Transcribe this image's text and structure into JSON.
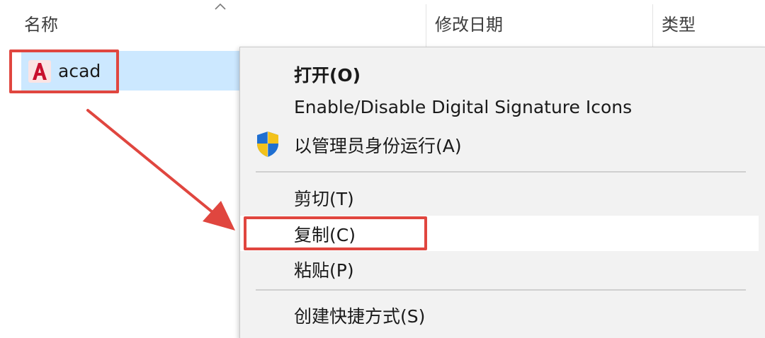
{
  "header": {
    "col_name": "名称",
    "col_date": "修改日期",
    "col_type": "类型"
  },
  "file": {
    "name": "acad",
    "icon": "autocad-icon"
  },
  "context_menu": {
    "items": [
      {
        "label": "打开(O)",
        "bold": true
      },
      {
        "label": "Enable/Disable Digital Signature Icons"
      },
      {
        "label": "以管理员身份运行(A)",
        "icon": "uac-shield-icon"
      },
      {
        "label": "剪切(T)"
      },
      {
        "label": "复制(C)",
        "highlighted": true
      },
      {
        "label": "粘贴(P)"
      },
      {
        "label": "创建快捷方式(S)"
      }
    ]
  },
  "colors": {
    "annotation": "#e0463f",
    "selection": "#cce8ff",
    "menu_bg": "#f2f2f2",
    "autocad_red": "#c8102e"
  }
}
